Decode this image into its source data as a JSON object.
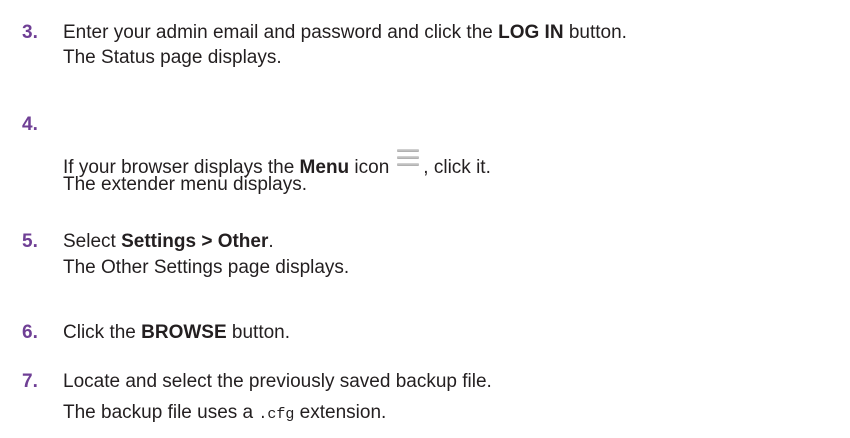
{
  "steps": [
    {
      "number": "3.",
      "line1": {
        "pre": "Enter your admin email and password and click the ",
        "bold": "LOG IN",
        "post": " button."
      },
      "line2": "The Status page displays."
    },
    {
      "number": "4.",
      "line1": {
        "pre": "If your browser displays the ",
        "bold": "Menu",
        "mid": " icon",
        "post": ", click it."
      },
      "line2": "The extender menu displays.",
      "icon": "menu-icon"
    },
    {
      "number": "5.",
      "line1": {
        "pre": "Select ",
        "bold": "Settings > Other",
        "post": "."
      },
      "line2": "The Other Settings page displays."
    },
    {
      "number": "6.",
      "line1": {
        "pre": "Click the ",
        "bold": "BROWSE",
        "post": " button."
      }
    },
    {
      "number": "7.",
      "line1": "Locate and select the previously saved backup file.",
      "line2": {
        "pre": "The backup file uses a ",
        "code": ".cfg",
        "post": " extension."
      }
    }
  ],
  "colors": {
    "step_number": "#6f3f95",
    "text": "#231f20"
  }
}
